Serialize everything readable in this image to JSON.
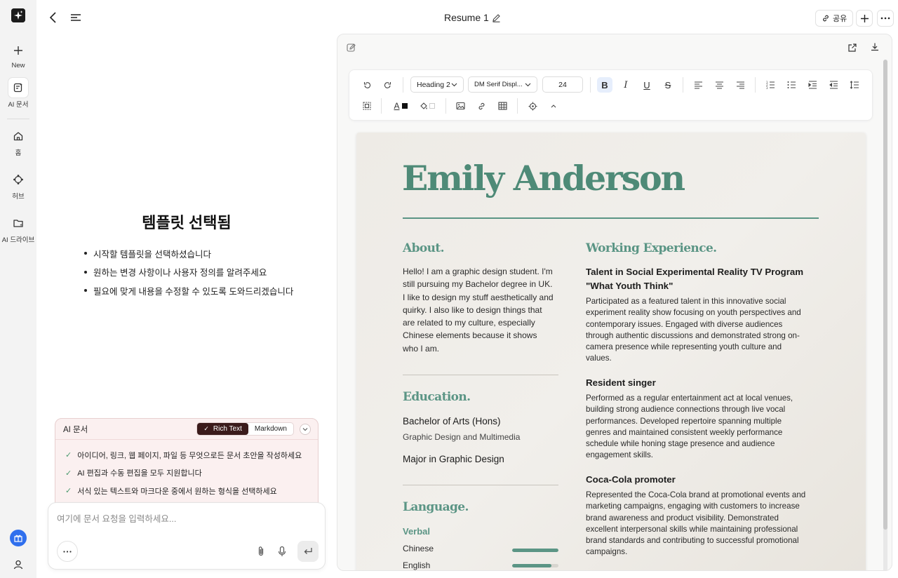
{
  "rail": {
    "items": [
      {
        "label": "New"
      },
      {
        "label": "AI 문서"
      },
      {
        "label": "홈"
      },
      {
        "label": "허브"
      },
      {
        "label": "AI 드라이브"
      }
    ]
  },
  "header": {
    "doc_title": "Resume 1",
    "share_label": "공유"
  },
  "template": {
    "title": "템플릿 선택됨",
    "points": [
      "시작할 템플릿을 선택하셨습니다",
      "원하는 변경 사항이나 사용자 정의를 알려주세요",
      "필요에 맞게 내용을 수정할 수 있도록 도와드리겠습니다"
    ]
  },
  "ai_card": {
    "name": "AI 문서",
    "mode_rich": "Rich Text",
    "mode_markdown": "Markdown",
    "features": [
      "아이디어, 링크, 웹 페이지, 파일 등 무엇으로든 문서 초안을 작성하세요",
      "AI 편집과 수동 편집을 모두 지원합니다",
      "서식 있는 텍스트와 마크다운 중에서 원하는 형식을 선택하세요"
    ]
  },
  "input": {
    "placeholder": "여기에 문서 요청을 입력하세요..."
  },
  "toolbar": {
    "heading_style": "Heading 2",
    "font_family": "DM Serif Displ...",
    "font_size": "24"
  },
  "resume": {
    "name": "Emily Anderson",
    "about": {
      "heading": "About.",
      "lines": [
        "Hello! I am a graphic design student. I'm",
        "still pursuing my Bachelor degree in UK.",
        "I like to design my stuff aesthetically and",
        "quirky. I also like to design things that",
        "are related to my culture, especially",
        "Chinese elements because it shows",
        "who I am."
      ]
    },
    "education": {
      "heading": "Education.",
      "degree": "Bachelor of Arts (Hons)",
      "field": "Graphic Design and Multimedia",
      "major": "Major in Graphic Design"
    },
    "language": {
      "heading": "Language.",
      "subheading": "Verbal",
      "items": [
        {
          "name": "Chinese",
          "level": 1.0
        },
        {
          "name": "English",
          "level": 0.85
        }
      ]
    },
    "experience": {
      "heading": "Working Experience.",
      "jobs": [
        {
          "title_lines": [
            "Talent in Social Experimental Reality TV Program",
            "\"What Youth Think\""
          ],
          "lines": [
            "Participated as a featured talent in this innovative social",
            "experiment reality show focusing on youth perspectives and",
            "contemporary issues. Engaged with diverse audiences",
            "through authentic discussions and demonstrated strong on-",
            "camera presence while representing youth culture and",
            "values."
          ]
        },
        {
          "title_lines": [
            "Resident singer"
          ],
          "lines": [
            "Performed as a regular entertainment act at local venues,",
            "building strong audience connections through live vocal",
            "performances. Developed repertoire spanning multiple",
            "genres and maintained consistent weekly performance",
            "schedule while honing stage presence and audience",
            "engagement skills."
          ]
        },
        {
          "title_lines": [
            "Coca-Cola promoter"
          ],
          "lines": [
            "Represented the Coca-Cola brand at promotional events and",
            "marketing campaigns, engaging with customers to increase",
            "brand awareness and product visibility. Demonstrated",
            "excellent interpersonal skills while maintaining professional",
            "brand standards and contributing to successful promotional",
            "campaigns."
          ]
        }
      ]
    }
  },
  "colors": {
    "accent": "#5b9585",
    "name_green": "#4e8a77",
    "mode_active": "#3b1b1b",
    "gift_blue": "#2f6fed"
  }
}
